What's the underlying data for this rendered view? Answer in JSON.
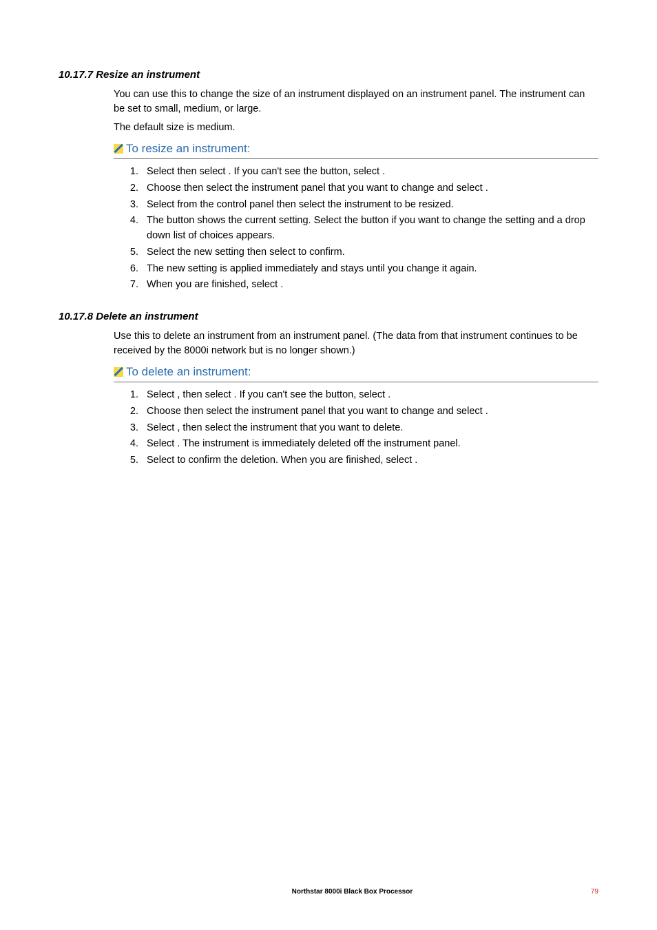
{
  "section1": {
    "heading": "10.17.7 Resize an instrument",
    "para1": "You can use this to change the size of an instrument displayed on an instrument panel. The instrument can be set to small, medium, or large.",
    "para2": "The default size is medium.",
    "procedure_title": "To resize an instrument:",
    "steps": [
      "Select             then select                    . If you can't see the                   button, select            .",
      "Choose                       then select the instrument panel that you want to change and select             .",
      "Select           from the control panel then select the instrument to be resized.",
      "The                              button shows the current setting. Select the button if you want to change the setting and a drop down list of choices appears.",
      "Select the new setting then select                        to confirm.",
      "The new setting is applied immediately and stays until you change it again.",
      "When you are finished, select           ."
    ]
  },
  "section2": {
    "heading": "10.17.8 Delete an instrument",
    "para1": "Use this to delete an instrument from an instrument panel. (The data from that instrument continues to be received by the 8000i network but is no longer shown.)",
    "procedure_title": "To delete an instrument:",
    "steps": [
      "Select             , then select                    . If you can't see the                   button, select            .",
      "Choose                       then select the instrument panel that you want to change and select               .",
      "Select          , then select the instrument that you want to delete.",
      "Select                             . The instrument is immediately deleted off the instrument panel.",
      "Select                        to confirm the deletion. When you are finished, select               ."
    ]
  },
  "footer": {
    "title": "Northstar 8000i Black Box Processor",
    "page": "79"
  }
}
